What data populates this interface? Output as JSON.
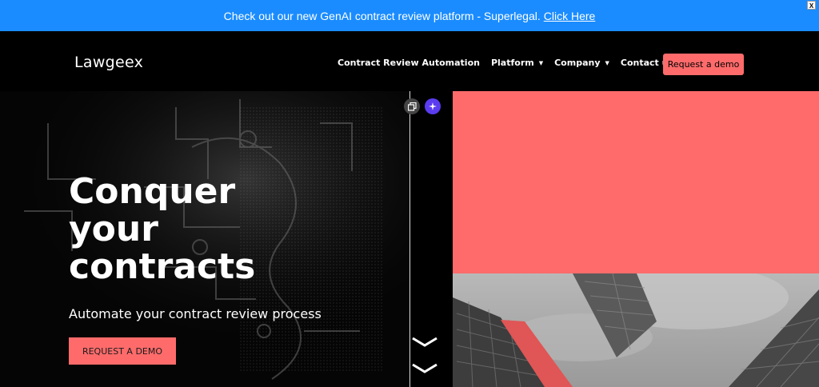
{
  "announcement": {
    "text": "Check out our new GenAI contract review platform - Superlegal.",
    "link": "Click Here",
    "close": "X"
  },
  "header": {
    "logo": "Lawgeex",
    "nav": [
      {
        "label": "Contract Review Automation"
      },
      {
        "label": "Platform"
      },
      {
        "label": "Company"
      },
      {
        "label": "Contact us"
      }
    ],
    "cta": "Request a demo"
  },
  "hero": {
    "title_lines": [
      "Conquer",
      "your",
      "contracts"
    ],
    "subtitle": "Automate your contract review process",
    "cta": "REQUEST A DEMO"
  },
  "icons": {
    "copy": "copy-icon",
    "ai": "sparkle-icon",
    "scroll": "chevron-down-icon"
  },
  "colors": {
    "announcement_bg": "#1a8cff",
    "accent": "#ff6b6b",
    "background": "#000000"
  }
}
